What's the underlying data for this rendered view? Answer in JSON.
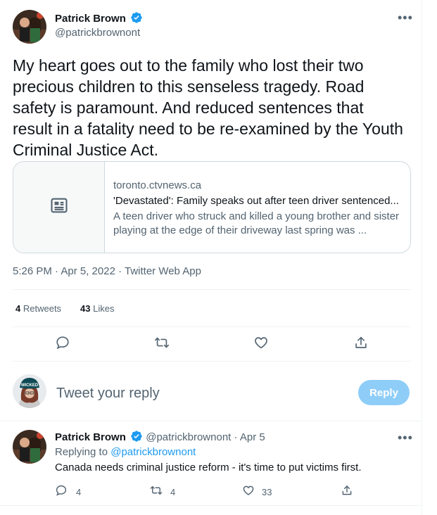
{
  "main_tweet": {
    "author_name": "Patrick Brown",
    "author_handle": "@patrickbrownont",
    "text_lines": [
      "My heart goes out to the family who lost their two",
      "precious children to this senseless tragedy. Road",
      "safety is paramount. And reduced sentences that",
      "result in a fatality need to be re-examined by the Youth",
      "Criminal Justice Act."
    ],
    "card": {
      "domain": "toronto.ctvnews.ca",
      "title": "'Devastated': Family speaks out after teen driver sentenced...",
      "description_lines": [
        "A teen driver who struck and killed a young brother and sister",
        "playing at the edge of their driveway last spring was ..."
      ],
      "icon": "article-icon"
    },
    "meta": "5:26 PM · Apr 5, 2022 · Twitter Web App",
    "stats": {
      "retweets_count": "4",
      "retweets_label": "Retweets",
      "likes_count": "43",
      "likes_label": "Likes"
    },
    "actions": [
      "reply-icon",
      "retweet-icon",
      "like-icon",
      "share-icon"
    ]
  },
  "compose": {
    "placeholder": "Tweet your reply",
    "button_label": "Reply",
    "avatar_text": "WICKED"
  },
  "reply_tweet": {
    "author_name": "Patrick Brown",
    "author_handle": "@patrickbrownont",
    "date": "· Apr 5",
    "replying_to_prefix": "Replying to",
    "replying_to_handle": "@patrickbrownont",
    "text": "Canada needs criminal justice reform - it's time to put victims first.",
    "reply_count": "4",
    "retweet_count": "4",
    "like_count": "33"
  },
  "colors": {
    "accent": "#1d9bf0",
    "reply_button_disabled": "#8ecdf8",
    "muted_text": "#536471",
    "border": "#cfd9de"
  }
}
